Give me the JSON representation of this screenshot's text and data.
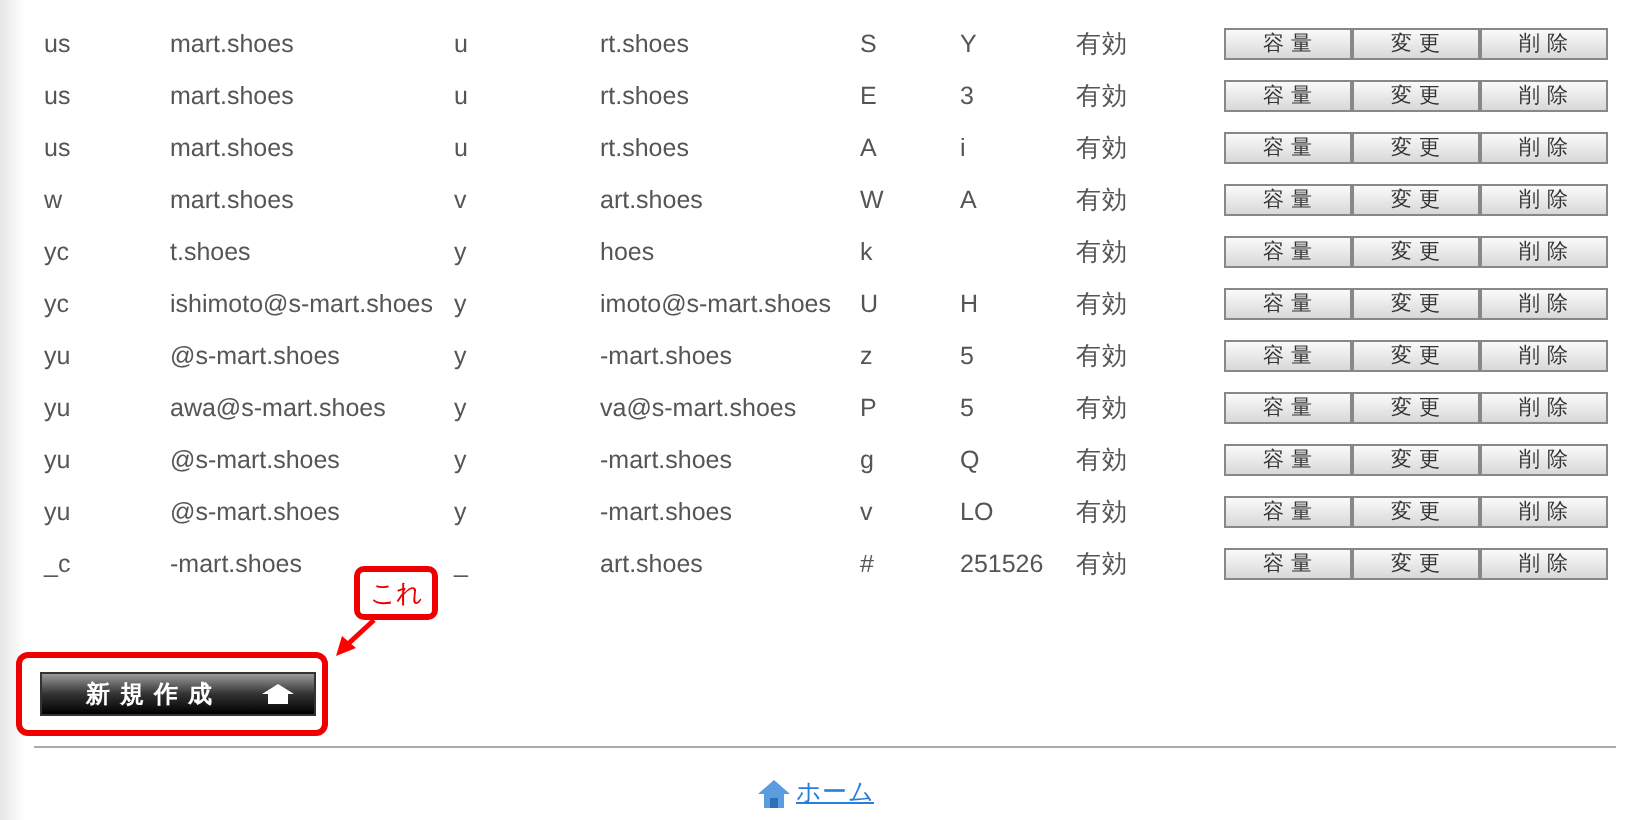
{
  "rows": [
    {
      "c1": "us",
      "c2": "mart.shoes",
      "c3": "u",
      "c4": "rt.shoes",
      "c5": "S",
      "c6": "Y",
      "status": "有効",
      "buttons": [
        "容 量",
        "変 更",
        "削 除"
      ]
    },
    {
      "c1": "us",
      "c2": "mart.shoes",
      "c3": "u",
      "c4": "rt.shoes",
      "c5": "E",
      "c6": "3",
      "status": "有効",
      "buttons": [
        "容 量",
        "変 更",
        "削 除"
      ]
    },
    {
      "c1": "us",
      "c2": "mart.shoes",
      "c3": "u",
      "c4": "rt.shoes",
      "c5": "A",
      "c6": "i",
      "status": "有効",
      "buttons": [
        "容 量",
        "変 更",
        "削 除"
      ]
    },
    {
      "c1": "w",
      "c2": "mart.shoes",
      "c3": "v",
      "c4": "art.shoes",
      "c5": "W",
      "c6": "A",
      "status": "有効",
      "buttons": [
        "容 量",
        "変 更",
        "削 除"
      ]
    },
    {
      "c1": "yc",
      "c2": "t.shoes",
      "c3": "y",
      "c4": "hoes",
      "c5": "k",
      "status": "有効",
      "buttons": [
        "容 量",
        "変 更",
        "削 除"
      ]
    },
    {
      "c1": "yc",
      "c2": "ishimoto@s-mart.shoes",
      "c3": "y",
      "c4": "imoto@s-mart.shoes",
      "c5": "U",
      "c6": "H",
      "status": "有効",
      "buttons": [
        "容 量",
        "変 更",
        "削 除"
      ]
    },
    {
      "c1": "yu",
      "c2": "@s-mart.shoes",
      "c3": "y",
      "c4": "-mart.shoes",
      "c5": "z",
      "c6": "5",
      "status": "有効",
      "buttons": [
        "容 量",
        "変 更",
        "削 除"
      ]
    },
    {
      "c1": "yu",
      "c2": "awa@s-mart.shoes",
      "c3": "y",
      "c4": "va@s-mart.shoes",
      "c5": "P",
      "c6": "5",
      "status": "有効",
      "buttons": [
        "容 量",
        "変 更",
        "削 除"
      ]
    },
    {
      "c1": "yu",
      "c2": "@s-mart.shoes",
      "c3": "y",
      "c4": "-mart.shoes",
      "c5": "g",
      "c6": "Q",
      "status": "有効",
      "buttons": [
        "容 量",
        "変 更",
        "削 除"
      ]
    },
    {
      "c1": "yu",
      "c2": "@s-mart.shoes",
      "c3": "y",
      "c4": "-mart.shoes",
      "c5": "v",
      "c6": "LO",
      "status": "有効",
      "buttons": [
        "容 量",
        "変 更",
        "削 除"
      ]
    },
    {
      "c1": "_c",
      "c2": "-mart.shoes",
      "c3": "_",
      "c4": "art.shoes",
      "c5": "#",
      "c6": "251526",
      "status": "有効",
      "buttons": [
        "容 量",
        "変 更",
        "削 除"
      ]
    }
  ],
  "annotation": "これ",
  "new_button": "新規作成",
  "home_link": "ホーム"
}
